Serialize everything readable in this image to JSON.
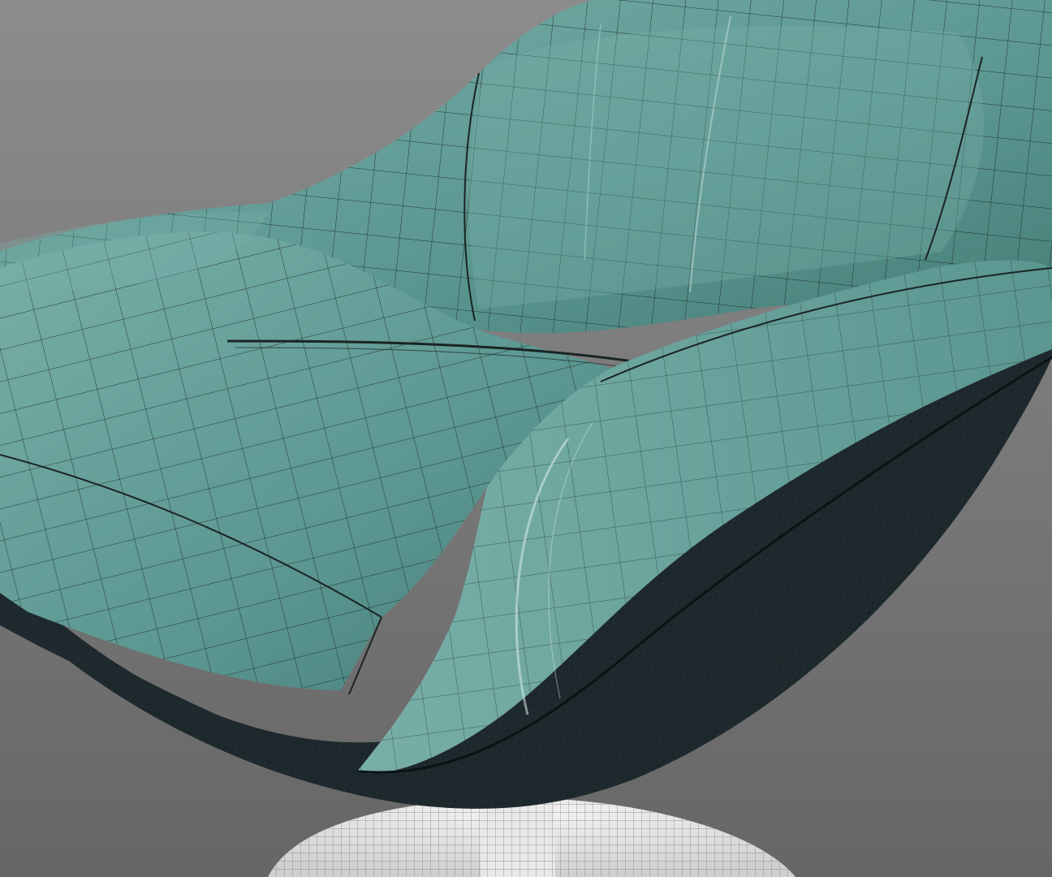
{
  "scene": {
    "subject": "chair-wireframe-render",
    "colors": {
      "background_top": "#8c8c8c",
      "background_bottom": "#666666",
      "upholstery": "#5b9690",
      "upholstery_light": "#78aea8",
      "upholstery_dark": "#447a74",
      "shell": "#1f2a2e",
      "base": "#e6e6e6",
      "wire": "#1a2424",
      "base_wire": "#7a7a7a"
    }
  }
}
